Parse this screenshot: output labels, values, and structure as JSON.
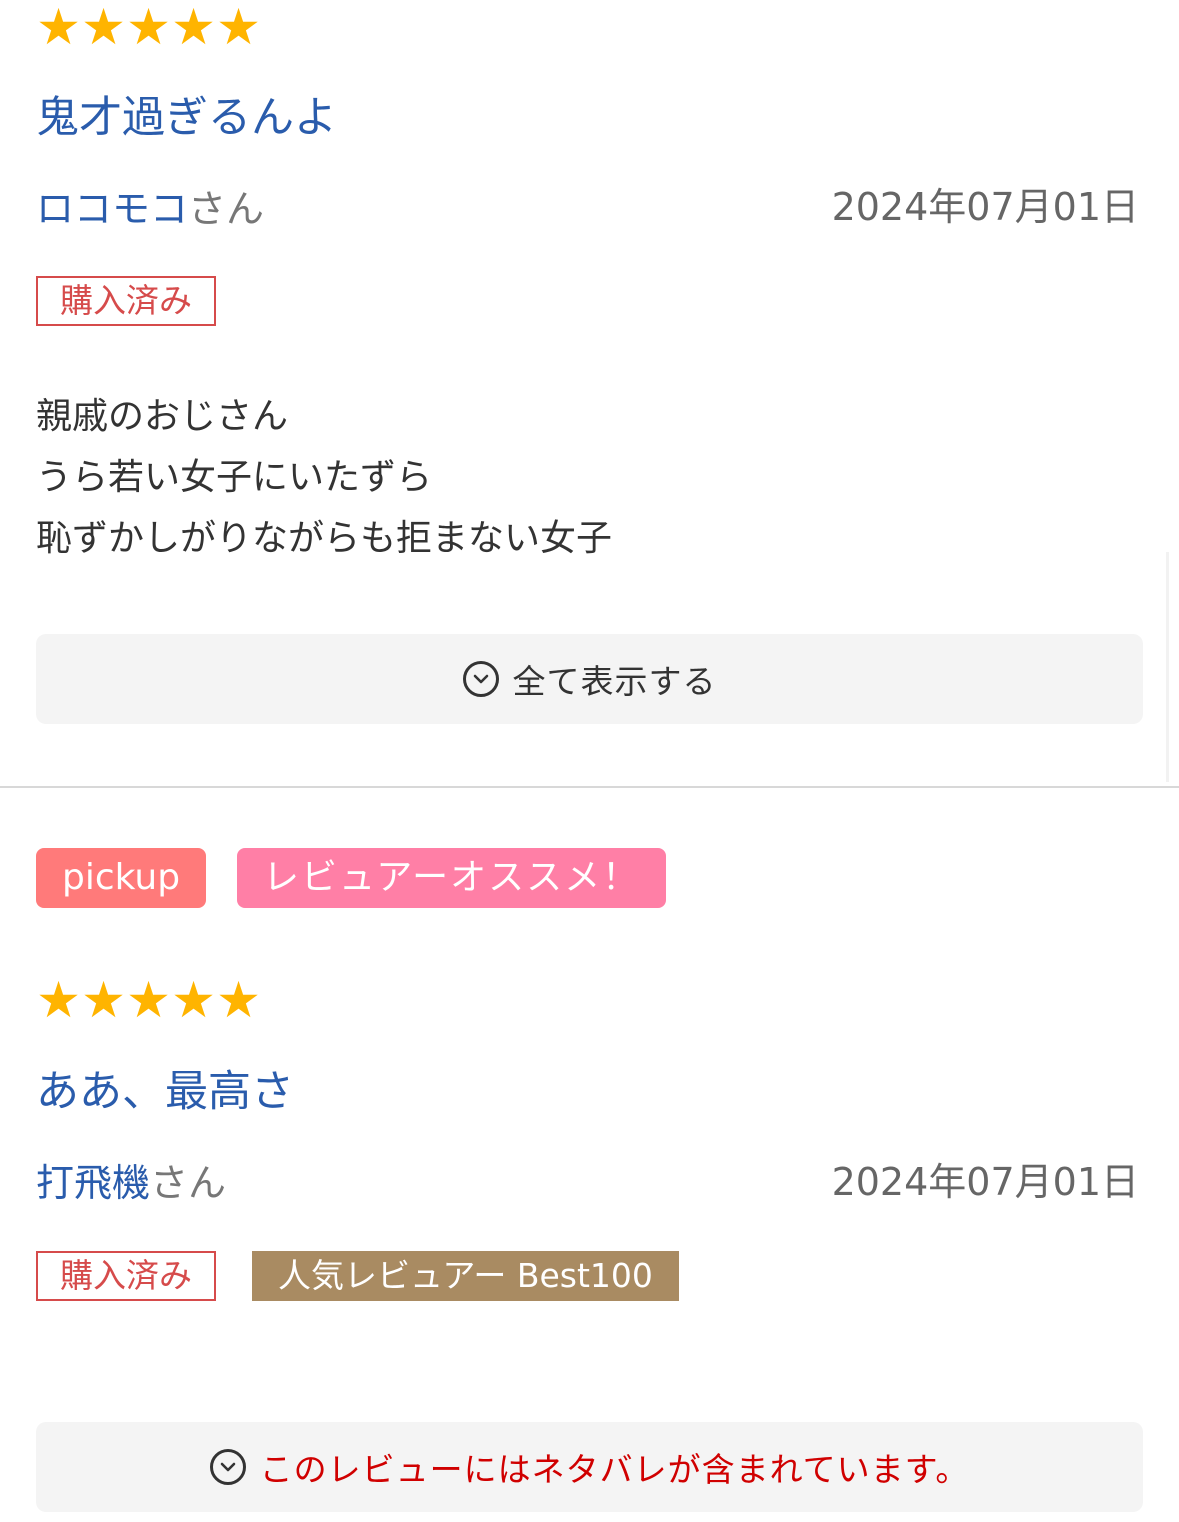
{
  "reviews": [
    {
      "rating": 5,
      "stars": [
        "★",
        "★",
        "★",
        "★",
        "★"
      ],
      "title": "鬼才過ぎるんよ",
      "reviewer_name": "ロコモコ",
      "reviewer_suffix": "さん",
      "date": "2024年07月01日",
      "purchased_label": "購入済み",
      "body_lines": [
        "親戚のおじさん",
        "うら若い女子にいたずら",
        "恥ずかしがりながらも拒まない女子"
      ],
      "expand_label": "全て表示する"
    },
    {
      "tags": [
        "pickup",
        "レビュアーオススメ！"
      ],
      "rating": 5,
      "stars": [
        "★",
        "★",
        "★",
        "★",
        "★"
      ],
      "title": "ああ、最高さ",
      "reviewer_name": "打飛機",
      "reviewer_suffix": "さん",
      "date": "2024年07月01日",
      "purchased_label": "購入済み",
      "popular_label": "人気レビュアー Best100",
      "spoiler_label": "このレビューにはネタバレが含まれています。"
    }
  ],
  "colors": {
    "star": "#ffb400",
    "title": "#2a5cac",
    "purchased": "#d64b4b",
    "pickup": "#ff7a7a",
    "recommend": "#ff7fa6",
    "popular": "#a98b62",
    "spoiler": "#d00000"
  },
  "icons": {
    "expand": "chevron-down-circle-icon"
  }
}
